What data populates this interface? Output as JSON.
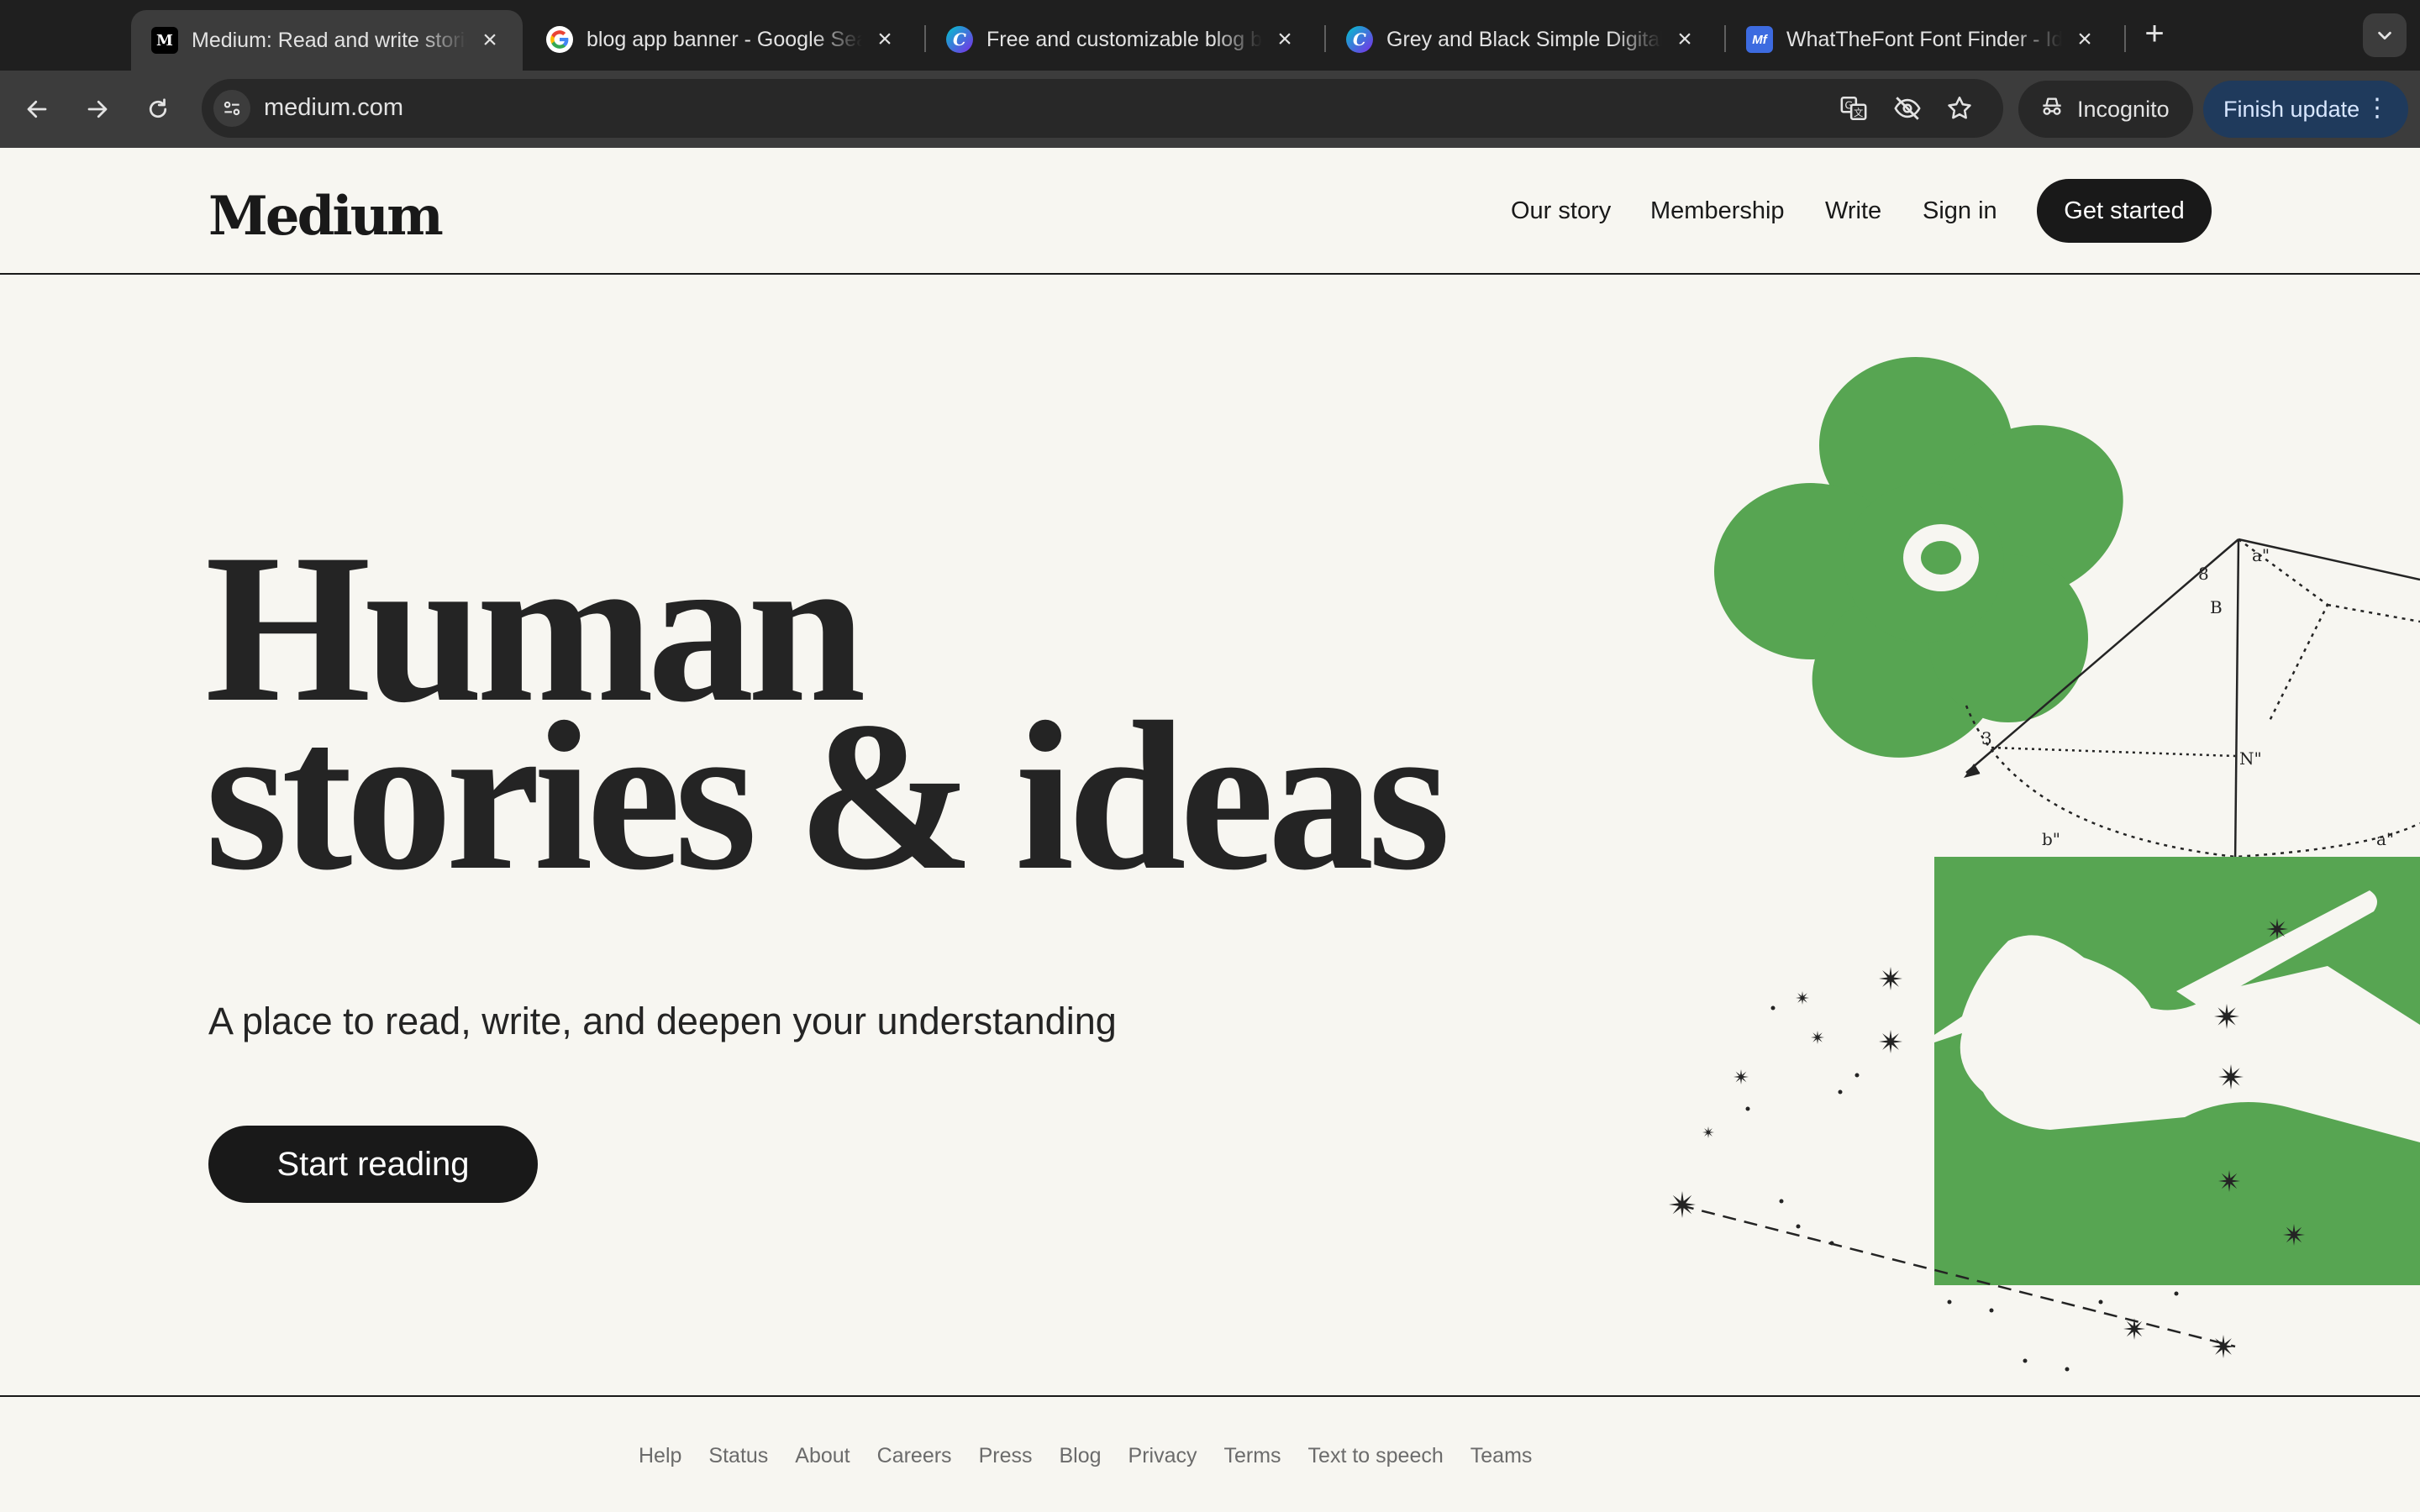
{
  "browser": {
    "tabs": [
      {
        "title": "Medium: Read and write stories",
        "favicon": "medium-favicon",
        "active": true
      },
      {
        "title": "blog app banner - Google Search",
        "favicon": "google-favicon",
        "active": false
      },
      {
        "title": "Free and customizable blog banner",
        "favicon": "canva-favicon",
        "active": false
      },
      {
        "title": "Grey and Black Simple Digital",
        "favicon": "canva-favicon",
        "active": false
      },
      {
        "title": "WhatTheFont Font Finder - Identify",
        "favicon": "whatthefont-favicon",
        "active": false
      }
    ],
    "url": "medium.com",
    "incognito_label": "Incognito",
    "update_label": "Finish update",
    "icons": [
      "back-icon",
      "forward-icon",
      "reload-icon",
      "site-info-icon",
      "translate-icon",
      "eye-off-icon",
      "star-icon",
      "incognito-icon",
      "more-icon",
      "new-tab-icon",
      "tab-search-icon"
    ]
  },
  "header": {
    "logo": "Medium",
    "nav": [
      "Our story",
      "Membership",
      "Write",
      "Sign in"
    ],
    "cta": "Get started"
  },
  "hero": {
    "title_line1": "Human",
    "title_line2": "stories & ideas",
    "subtitle": "A place to read, write, and deepen your understanding",
    "cta": "Start reading"
  },
  "footer": {
    "links": [
      "Help",
      "Status",
      "About",
      "Careers",
      "Press",
      "Blog",
      "Privacy",
      "Terms",
      "Text to speech",
      "Teams"
    ]
  },
  "colors": {
    "page_bg": "#f7f6f1",
    "ink": "#191919",
    "illustration_green": "#57a552",
    "chrome_dark": "#1f1f1f",
    "chrome_toolbar": "#3c3c3c"
  }
}
